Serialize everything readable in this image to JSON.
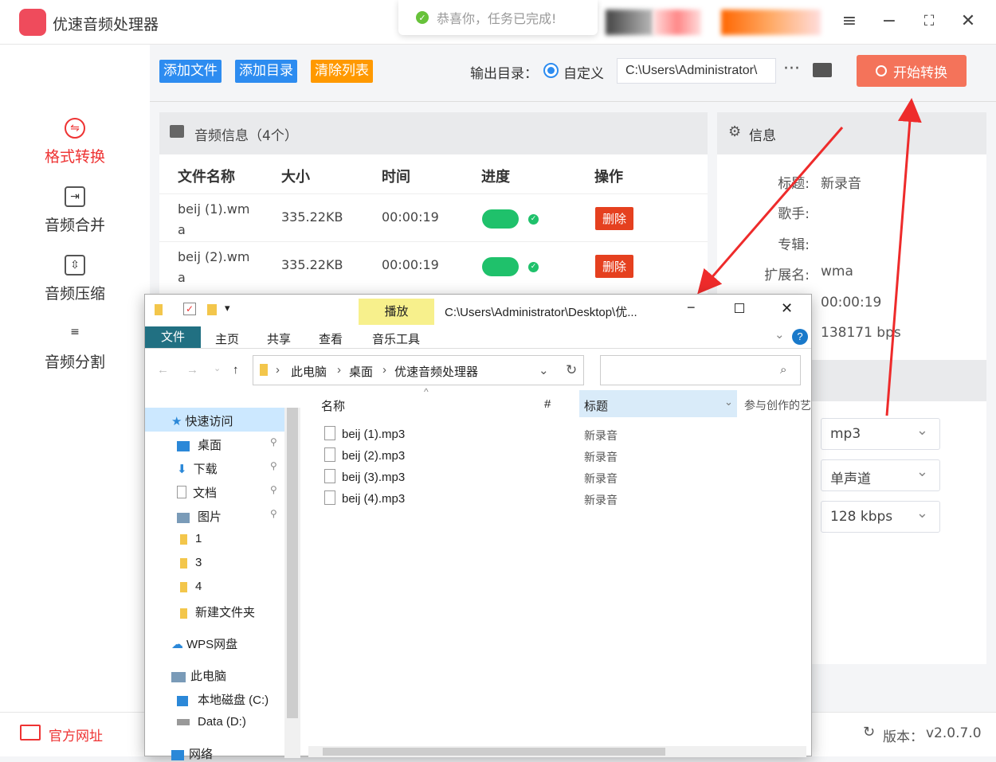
{
  "app": {
    "title": "优速音频处理器",
    "version_label": "版本：",
    "version": "v2.0.7.0",
    "website": "官方网址"
  },
  "toast": {
    "message": "恭喜你，任务已完成!"
  },
  "sidebar": {
    "items": [
      {
        "label": "格式转换",
        "icon": "format-convert-icon",
        "active": true
      },
      {
        "label": "音频合并",
        "icon": "merge-icon"
      },
      {
        "label": "音频压缩",
        "icon": "compress-icon"
      },
      {
        "label": "音频分割",
        "icon": "split-icon"
      }
    ]
  },
  "toolbar": {
    "add_file": "添加文件",
    "add_dir": "添加目录",
    "clear": "清除列表",
    "output_label": "输出目录：",
    "custom": "自定义",
    "path": "C:\\Users\\Administrator\\",
    "more": "···",
    "start": "开始转换"
  },
  "list": {
    "header": "音频信息（4个）",
    "columns": [
      "文件名称",
      "大小",
      "时间",
      "进度",
      "操作"
    ],
    "rows": [
      {
        "name_l1": "beij (1).wm",
        "name_l2": "a",
        "size": "335.22KB",
        "time": "00:00:19",
        "progress": 1.0,
        "action": "删除"
      },
      {
        "name_l1": "beij (2).wm",
        "name_l2": "a",
        "size": "335.22KB",
        "time": "00:00:19",
        "progress": 1.0,
        "action": "删除"
      }
    ]
  },
  "info": {
    "header": "信息",
    "title_k": "标题:",
    "title_v": "新录音",
    "artist_k": "歌手:",
    "album_k": "专辑:",
    "ext_k": "扩展名:",
    "ext_v": "wma",
    "duration_v": "00:00:19",
    "bitrate_v": "138171 bps",
    "format": "mp3",
    "channel": "单声道",
    "kbps": "128 kbps"
  },
  "explorer": {
    "title": "C:\\Users\\Administrator\\Desktop\\优...",
    "play_tab": "播放",
    "tabs": [
      "文件",
      "主页",
      "共享",
      "查看",
      "音乐工具"
    ],
    "crumbs": [
      "此电脑",
      "桌面",
      "优速音频处理器"
    ],
    "nav": [
      "快速访问",
      "桌面",
      "下载",
      "文档",
      "图片",
      "1",
      "3",
      "4",
      "新建文件夹",
      "WPS网盘",
      "此电脑",
      "本地磁盘 (C:)",
      "Data (D:)",
      "网络"
    ],
    "col_name": "名称",
    "col_num": "#",
    "col_title": "标题",
    "col_contrib": "参与创作的艺",
    "files": [
      {
        "name": "beij (1).mp3",
        "title": "新录音"
      },
      {
        "name": "beij (2).mp3",
        "title": "新录音"
      },
      {
        "name": "beij (3).mp3",
        "title": "新录音"
      },
      {
        "name": "beij (4).mp3",
        "title": "新录音"
      }
    ]
  },
  "colors": {
    "accent": "#2d8cf0",
    "orange": "#ff9900",
    "start": "#f4735a",
    "delete": "#e5401f",
    "active": "#e33333"
  }
}
